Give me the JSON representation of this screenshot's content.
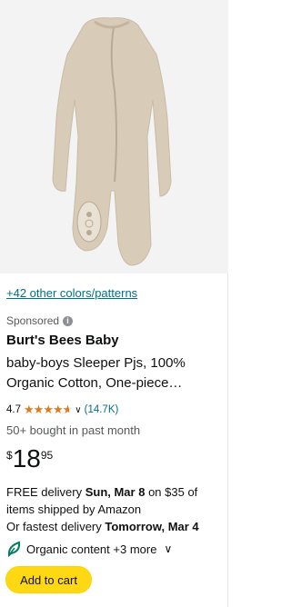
{
  "product": {
    "image_alt": "Beige footed sleeper pajama",
    "colors_link": "+42 other colors/patterns",
    "sponsored": "Sponsored",
    "brand": "Burt's Bees Baby",
    "title_line1": "baby-boys Sleeper Pjs, 100%",
    "title_line2": "Organic Cotton, One-piece…",
    "rating": "4.7",
    "rating_value": 4.7,
    "review_count": "(14.7K)",
    "bought": "50+ bought in past month",
    "price_symbol": "$",
    "price_whole": "18",
    "price_fraction": "95",
    "delivery_line1_prefix": "FREE delivery ",
    "delivery_line1_date": "Sun, Mar 8",
    "delivery_line1_suffix": " on $35 of",
    "delivery_line2": "items shipped by Amazon",
    "delivery_line3_prefix": "Or fastest delivery ",
    "delivery_line3_date": "Tomorrow, Mar 4",
    "organic_label": "Organic content +3 more",
    "add_to_cart": "Add to cart"
  },
  "colors": {
    "link": "#007185",
    "star": "#de7921",
    "button": "#ffd814",
    "product": "#d8cbb8"
  },
  "icons": [
    "info-icon",
    "star-icon",
    "chevron-down-icon",
    "leaf-icon"
  ]
}
